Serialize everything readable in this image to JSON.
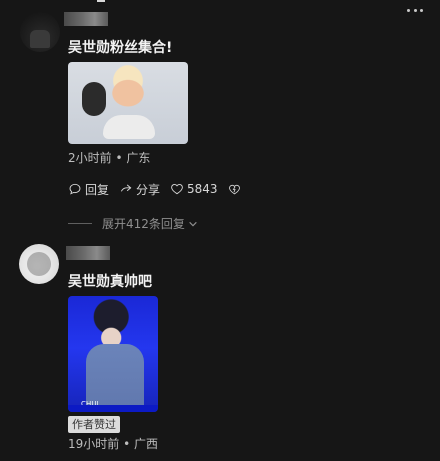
{
  "comments": [
    {
      "text": "吴世勋粉丝集合!",
      "meta": "2小时前 • 广东",
      "actions": {
        "reply_label": "回复",
        "share_label": "分享",
        "like_count": "5843"
      },
      "expand_replies_label": "展开412条回复"
    },
    {
      "text": "吴世勋真帅吧",
      "image_caption": "CHUI",
      "badge": "作者赞过",
      "meta": "19小时前 • 广西"
    }
  ],
  "icons": {
    "reply": "reply-icon",
    "share": "share-icon",
    "like": "heart-icon",
    "dislike": "dislike-icon",
    "more": "more-icon"
  }
}
